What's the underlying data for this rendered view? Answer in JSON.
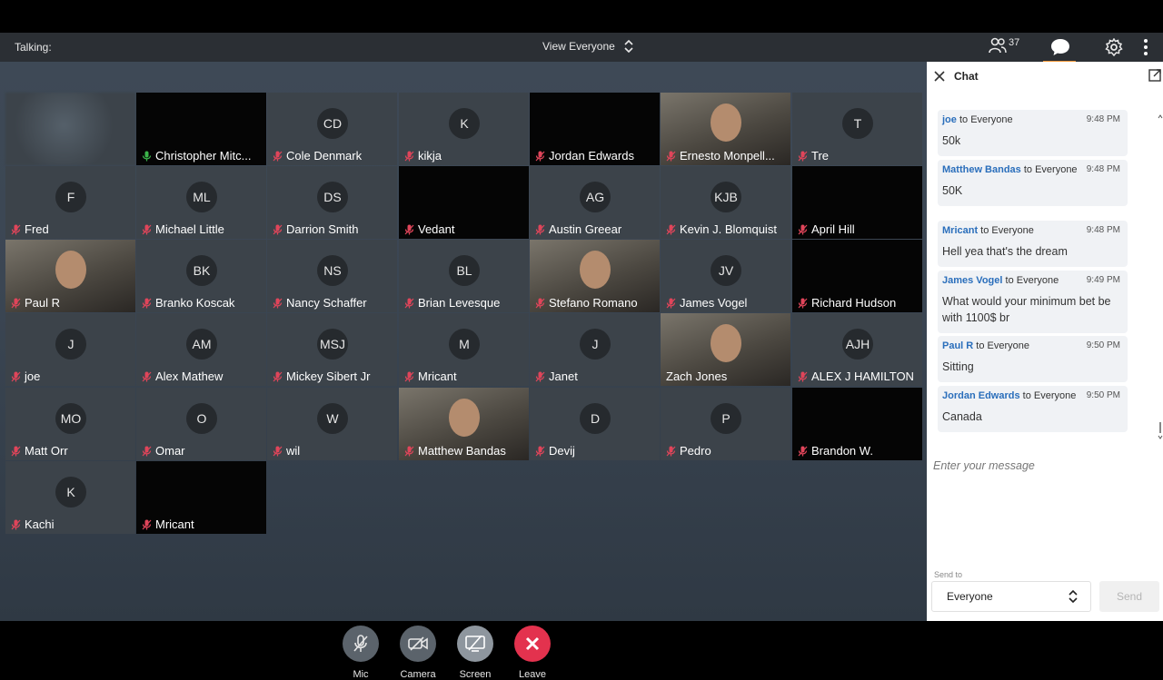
{
  "topbar": {
    "talking_label": "Talking:",
    "view_label": "View Everyone",
    "participant_count": "37",
    "accent_color": "#f29a3a"
  },
  "tiles": [
    {
      "row": 0,
      "col": 0,
      "name": "",
      "kind": "blur"
    },
    {
      "row": 0,
      "col": 1,
      "name": "Christopher Mitc...",
      "kind": "dark",
      "mic": "on"
    },
    {
      "row": 0,
      "col": 2,
      "name": "Cole Denmark",
      "initials": "CD"
    },
    {
      "row": 0,
      "col": 3,
      "name": "kikja",
      "initials": "K"
    },
    {
      "row": 0,
      "col": 4,
      "name": "Jordan Edwards",
      "kind": "dark"
    },
    {
      "row": 0,
      "col": 5,
      "name": "Ernesto Monpell...",
      "kind": "video"
    },
    {
      "row": 0,
      "col": 6,
      "name": "Tre",
      "initials": "T"
    },
    {
      "row": 1,
      "col": 0,
      "name": "Fred",
      "initials": "F"
    },
    {
      "row": 1,
      "col": 1,
      "name": "Michael Little",
      "initials": "ML"
    },
    {
      "row": 1,
      "col": 2,
      "name": "Darrion Smith",
      "initials": "DS"
    },
    {
      "row": 1,
      "col": 3,
      "name": "Vedant",
      "kind": "dark"
    },
    {
      "row": 1,
      "col": 4,
      "name": "Austin Greear",
      "initials": "AG"
    },
    {
      "row": 1,
      "col": 5,
      "name": "Kevin J. Blomquist",
      "initials": "KJB"
    },
    {
      "row": 1,
      "col": 6,
      "name": "April Hill",
      "kind": "dark"
    },
    {
      "row": 2,
      "col": 0,
      "name": "Paul R",
      "kind": "video"
    },
    {
      "row": 2,
      "col": 1,
      "name": "Branko Koscak",
      "initials": "BK"
    },
    {
      "row": 2,
      "col": 2,
      "name": "Nancy Schaffer",
      "initials": "NS"
    },
    {
      "row": 2,
      "col": 3,
      "name": "Brian Levesque",
      "initials": "BL"
    },
    {
      "row": 2,
      "col": 4,
      "name": "Stefano Romano",
      "kind": "video"
    },
    {
      "row": 2,
      "col": 5,
      "name": "James Vogel",
      "initials": "JV"
    },
    {
      "row": 2,
      "col": 6,
      "name": "Richard Hudson",
      "kind": "dark"
    },
    {
      "row": 3,
      "col": 0,
      "name": "joe",
      "initials": "J"
    },
    {
      "row": 3,
      "col": 1,
      "name": "Alex Mathew",
      "initials": "AM"
    },
    {
      "row": 3,
      "col": 2,
      "name": "Mickey Sibert Jr",
      "initials": "MSJ"
    },
    {
      "row": 3,
      "col": 3,
      "name": "Mricant",
      "initials": "M"
    },
    {
      "row": 3,
      "col": 4,
      "name": "Janet",
      "initials": "J"
    },
    {
      "row": 3,
      "col": 5,
      "name": "Zach Jones",
      "kind": "video",
      "mic": "none"
    },
    {
      "row": 3,
      "col": 6,
      "name": "ALEX J HAMILTON",
      "initials": "AJH"
    },
    {
      "row": 4,
      "col": 0,
      "name": "Matt Orr",
      "initials": "MO"
    },
    {
      "row": 4,
      "col": 1,
      "name": "Omar",
      "initials": "O"
    },
    {
      "row": 4,
      "col": 2,
      "name": "wil",
      "initials": "W"
    },
    {
      "row": 4,
      "col": 3,
      "name": "Matthew Bandas",
      "kind": "video"
    },
    {
      "row": 4,
      "col": 4,
      "name": "Devij",
      "initials": "D"
    },
    {
      "row": 4,
      "col": 5,
      "name": "Pedro",
      "initials": "P"
    },
    {
      "row": 4,
      "col": 6,
      "name": "Brandon W.",
      "kind": "dark"
    },
    {
      "row": 5,
      "col": 0,
      "name": "Kachi",
      "initials": "K"
    },
    {
      "row": 5,
      "col": 1,
      "name": "Mricant",
      "kind": "dark"
    }
  ],
  "controls": {
    "mic_label": "Mic",
    "camera_label": "Camera",
    "screen_label": "Screen",
    "leave_label": "Leave",
    "leave_color": "#e3324e"
  },
  "chat": {
    "title": "Chat",
    "messages": [
      {
        "sender": "joe",
        "to": " to Everyone",
        "time": "9:48 PM",
        "text": "50k"
      },
      {
        "sender": "Matthew Bandas",
        "to": " to Everyone",
        "time": "9:48 PM",
        "text": "50K"
      },
      {
        "sender": "Mricant",
        "to": " to Everyone",
        "time": "9:48 PM",
        "text": "Hell yea that's the dream"
      },
      {
        "sender": "James Vogel",
        "to": " to Everyone",
        "time": "9:49 PM",
        "text": "What would your minimum bet be with 1100$ br"
      },
      {
        "sender": "Paul R",
        "to": " to Everyone",
        "time": "9:50 PM",
        "text": "Sitting"
      },
      {
        "sender": "Jordan Edwards",
        "to": " to Everyone",
        "time": "9:50 PM",
        "text": "Canada"
      }
    ],
    "compose_placeholder": "Enter your message",
    "send_to_label": "Send to",
    "send_to_value": "Everyone",
    "send_button": "Send",
    "sender_color": "#2a6ebb"
  }
}
